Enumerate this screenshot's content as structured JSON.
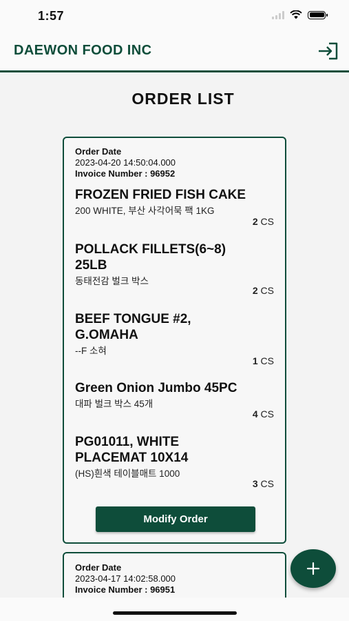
{
  "status_bar": {
    "time": "1:57"
  },
  "header": {
    "app_title": "DAEWON FOOD INC",
    "logout_icon": "logout-icon"
  },
  "page_title": "ORDER LIST",
  "orders": [
    {
      "date_label": "Order Date",
      "date": "2023-04-20 14:50:04.000",
      "invoice": "Invoice Number : 96952",
      "items": [
        {
          "name": "FROZEN FRIED FISH CAKE",
          "desc": "200 WHITE, 부산 사각어묵 팩 1KG",
          "qty": "2",
          "unit": "CS"
        },
        {
          "name": "POLLACK FILLETS(6~8) 25LB",
          "desc": "동태전감 벌크 박스",
          "qty": "2",
          "unit": "CS"
        },
        {
          "name": "BEEF TONGUE #2, G.OMAHA",
          "desc": "--F 소혀",
          "qty": "1",
          "unit": "CS"
        },
        {
          "name": "Green Onion Jumbo 45PC",
          "desc": "대파 벌크 박스  45개",
          "qty": "4",
          "unit": "CS"
        },
        {
          "name": "PG01011,  WHITE PLACEMAT 10X14",
          "desc": "(HS)흰색 테이블매트 1000",
          "qty": "3",
          "unit": "CS"
        }
      ],
      "button_label": "Modify Order"
    },
    {
      "date_label": "Order Date",
      "date": "2023-04-17 14:02:58.000",
      "invoice": "Invoice Number : 96951"
    }
  ],
  "fab": {
    "icon": "plus-icon",
    "label": "+"
  },
  "colors": {
    "primary": "#0e4d3a",
    "background": "#f3f3f3"
  }
}
